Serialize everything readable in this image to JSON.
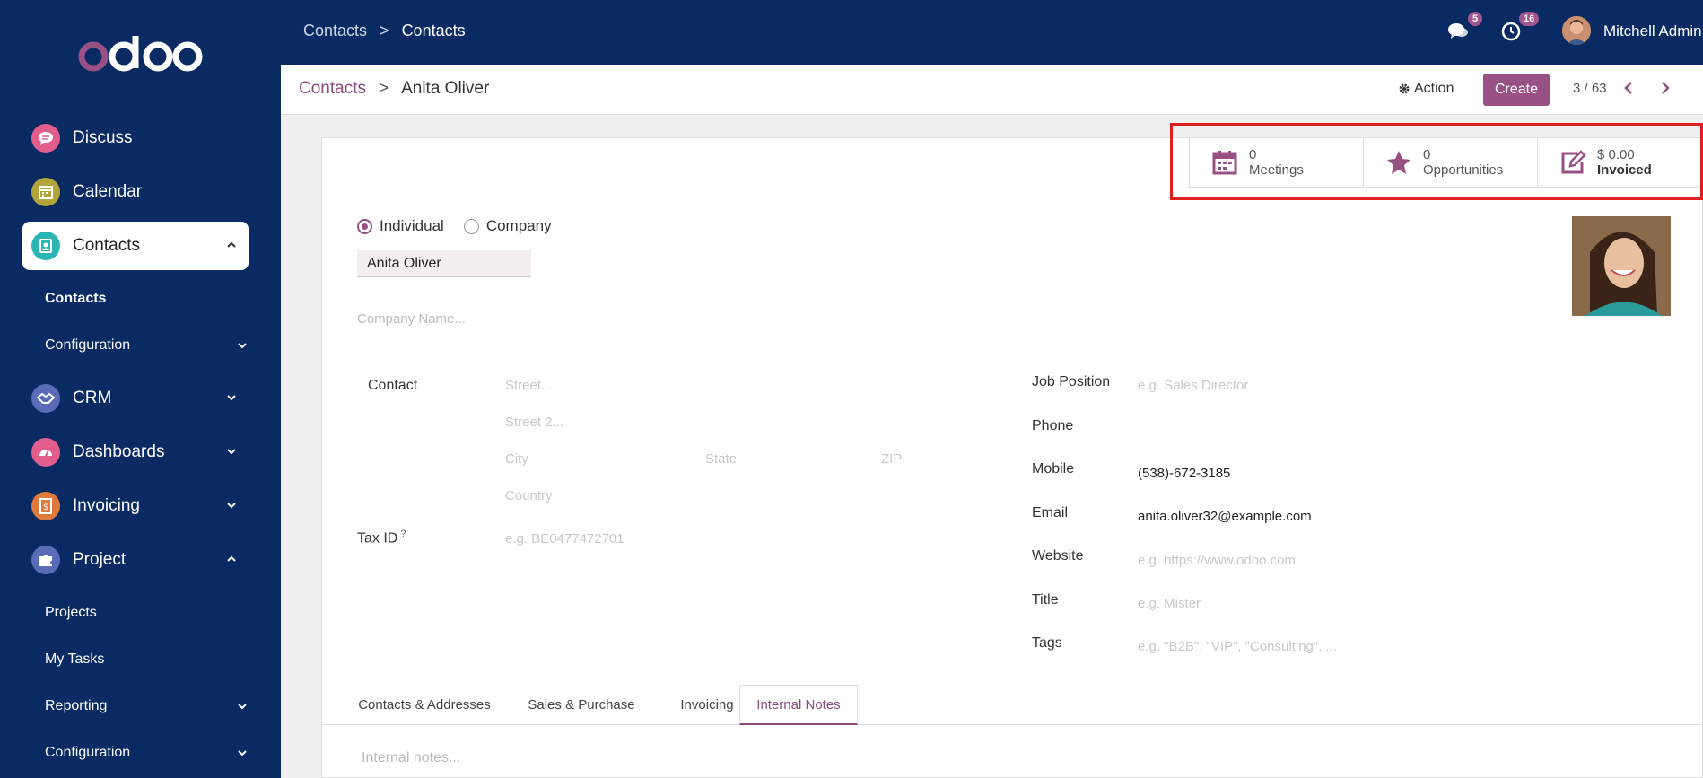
{
  "sidebar": {
    "logo_text": "odoo",
    "items": [
      {
        "label": "Discuss",
        "icon": "discuss-icon",
        "color": "#e05d8c"
      },
      {
        "label": "Calendar",
        "icon": "calendar-icon",
        "color": "#b3a53a"
      },
      {
        "label": "Contacts",
        "icon": "contacts-icon",
        "color": "#2bb5b5"
      },
      {
        "label": "CRM",
        "icon": "handshake-icon",
        "color": "#5a6bb8"
      },
      {
        "label": "Dashboards",
        "icon": "dashboard-icon",
        "color": "#e05d8c"
      },
      {
        "label": "Invoicing",
        "icon": "invoice-icon",
        "color": "#e07a3a"
      },
      {
        "label": "Project",
        "icon": "puzzle-icon",
        "color": "#5a6bb8"
      }
    ],
    "contacts_sub": [
      "Contacts",
      "Configuration"
    ],
    "project_sub": [
      "Projects",
      "My Tasks",
      "Reporting",
      "Configuration"
    ]
  },
  "topbar": {
    "breadcrumb": [
      "Contacts",
      ">",
      "Contacts"
    ],
    "messages_count": "5",
    "activities_count": "16",
    "user_name": "Mitchell Admin"
  },
  "control": {
    "breadcrumb_root": "Contacts",
    "separator": ">",
    "record_name": "Anita Oliver",
    "action_label": "Action",
    "create_label": "Create",
    "pager": "3 / 63"
  },
  "stats": [
    {
      "value": "0",
      "label": "Meetings",
      "icon": "calendar-icon"
    },
    {
      "value": "0",
      "label": "Opportunities",
      "icon": "star-icon"
    },
    {
      "value": "$ 0.00",
      "label": "Invoiced",
      "icon": "edit-icon"
    }
  ],
  "form": {
    "type_individual": "Individual",
    "type_company": "Company",
    "name": "Anita Oliver",
    "company_placeholder": "Company Name...",
    "contact_label": "Contact",
    "street_ph": "Street...",
    "street2_ph": "Street 2...",
    "city_ph": "City",
    "state_ph": "State",
    "zip_ph": "ZIP",
    "country_ph": "Country",
    "taxid_label": "Tax ID",
    "taxid_help": "?",
    "taxid_ph": "e.g. BE0477472701",
    "job_label": "Job Position",
    "job_ph": "e.g. Sales Director",
    "phone_label": "Phone",
    "mobile_label": "Mobile",
    "mobile_value": "(538)-672-3185",
    "email_label": "Email",
    "email_value": "anita.oliver32@example.com",
    "website_label": "Website",
    "website_ph": "e.g. https://www.odoo.com",
    "title_label": "Title",
    "title_ph": "e.g. Mister",
    "tags_label": "Tags",
    "tags_ph": "e.g. \"B2B\", \"VIP\", \"Consulting\", ..."
  },
  "tabs": [
    "Contacts & Addresses",
    "Sales & Purchase",
    "Invoicing",
    "Internal Notes"
  ],
  "notes_placeholder": "Internal notes...",
  "colors": {
    "brand": "#985184",
    "nav_bg": "#0a2a63",
    "highlight": "#e02020"
  }
}
